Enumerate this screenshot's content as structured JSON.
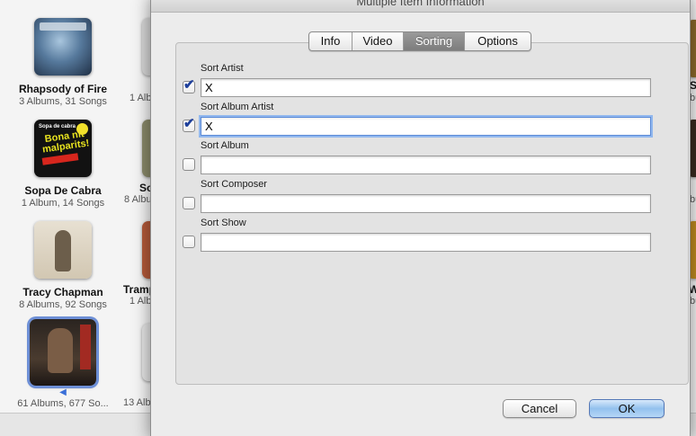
{
  "background": {
    "artists": [
      {
        "name": "Rhapsody of Fire",
        "meta": "3 Albums, 31 Songs"
      },
      {
        "name": "Sopa De Cabra",
        "meta": "1 Album, 14 Songs",
        "art_text": [
          "Sopa de cabra",
          "Bona nit malparits!"
        ]
      },
      {
        "name": "Tracy Chapman",
        "meta": "8 Albums, 92 Songs"
      },
      {
        "name": "",
        "meta": "61 Albums, 677 So...",
        "playing_icon": "speaker-icon",
        "playing_glyph": "◀"
      }
    ],
    "second_column": [
      {
        "meta": "1 Alb"
      },
      {
        "name": "So",
        "meta": "8 Albu"
      },
      {
        "name": "Tramp",
        "meta": "1 Alb"
      },
      {
        "meta": "13 Alb"
      }
    ],
    "right_edge": [
      {
        "name": "S",
        "meta": "bu"
      },
      {
        "meta": "bu"
      },
      {
        "name": "W",
        "meta": "bu"
      }
    ]
  },
  "dialog": {
    "title": "Multiple Item Information",
    "tabs": [
      {
        "label": "Info",
        "active": false
      },
      {
        "label": "Video",
        "active": false
      },
      {
        "label": "Sorting",
        "active": true
      },
      {
        "label": "Options",
        "active": false
      }
    ],
    "fields": [
      {
        "label": "Sort Artist",
        "checked": true,
        "value": "X",
        "focused": false
      },
      {
        "label": "Sort Album Artist",
        "checked": true,
        "value": "X",
        "focused": true
      },
      {
        "label": "Sort Album",
        "checked": false,
        "value": "",
        "focused": false
      },
      {
        "label": "Sort Composer",
        "checked": false,
        "value": "",
        "focused": false
      },
      {
        "label": "Sort Show",
        "checked": false,
        "value": "",
        "focused": false
      }
    ],
    "check_glyph": "✔",
    "buttons": {
      "cancel": "Cancel",
      "ok": "OK"
    }
  }
}
